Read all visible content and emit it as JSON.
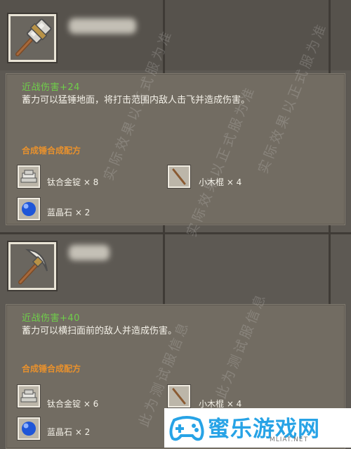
{
  "items": [
    {
      "stat": "近战伤害+24",
      "description": "蓄力可以猛锤地面，将打击范围内敌人击飞并造成伤害。",
      "recipe_title": "合成锤合成配方",
      "materials": [
        {
          "icon": "titanium-ingot-icon",
          "label": "钛合金锭 × 8"
        },
        {
          "icon": "wooden-stick-icon",
          "label": "小木棍 × 4"
        },
        {
          "icon": "sapphire-icon",
          "label": "蓝晶石 × 2"
        }
      ]
    },
    {
      "stat": "近战伤害+40",
      "description": "蓄力可以横扫面前的敌人并造成伤害。",
      "recipe_title": "合成锤合成配方",
      "materials": [
        {
          "icon": "titanium-ingot-icon",
          "label": "钛合金锭 × 6"
        },
        {
          "icon": "wooden-stick-icon",
          "label": "小木棍 × 4"
        },
        {
          "icon": "sapphire-icon",
          "label": "蓝晶石 × 2"
        }
      ]
    }
  ],
  "watermark": "实际效果以正式服为准",
  "watermark_2": "此为测试服信息",
  "logo": {
    "text": "蜜乐游戏网",
    "url": "MLIAT.NET"
  },
  "colors": {
    "stat": "#6fcf4a",
    "recipe": "#e8912d",
    "text": "#f4f1e8",
    "card": "#726c62",
    "logo": "#27a3e6"
  }
}
